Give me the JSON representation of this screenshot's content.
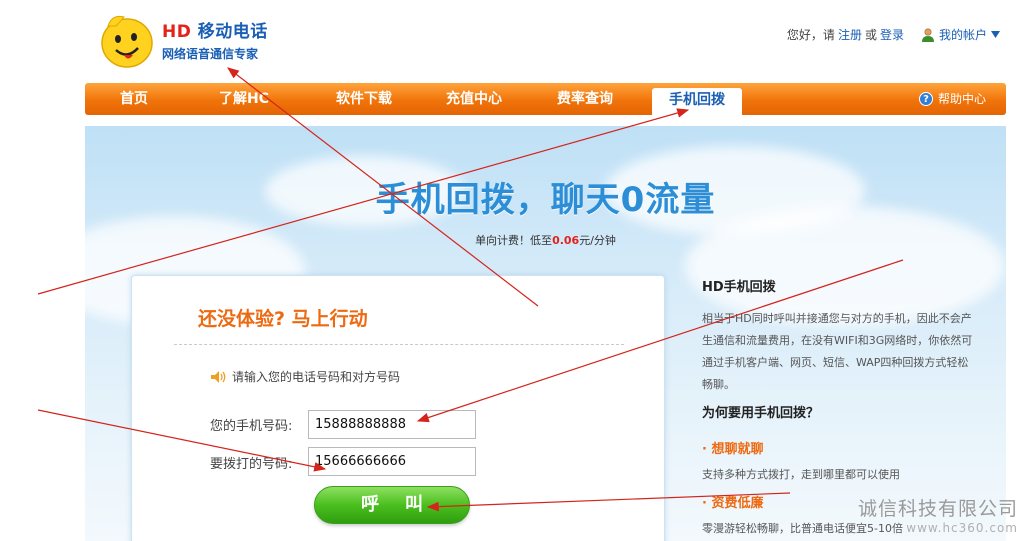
{
  "brand": {
    "name_prefix": "HD",
    "name_rest": " 移动电话",
    "slogan": "网络语音通信专家"
  },
  "top_links": {
    "greeting": "您好，请",
    "register": "注册",
    "or": "或",
    "login": "登录",
    "account": "我的帐户"
  },
  "nav": {
    "items": [
      {
        "label": "首页"
      },
      {
        "label": "了解HC"
      },
      {
        "label": "软件下载"
      },
      {
        "label": "充值中心"
      },
      {
        "label": "费率查询"
      },
      {
        "label": "手机回拨",
        "active": true
      }
    ],
    "help": "帮助中心"
  },
  "hero": {
    "title": "手机回拨，聊天0流量",
    "sub_prefix": "单向计费！低至",
    "price": "0.06",
    "sub_suffix": "元/分钟"
  },
  "form": {
    "title": "还没体验? 马上行动",
    "hint": "请输入您的电话号码和对方号码",
    "my_phone_label": "您的手机号码:",
    "my_phone_value": "15888888888",
    "dial_label": "要拨打的号码:",
    "dial_value": "15666666666",
    "call_button": "呼叫"
  },
  "info": {
    "title": "HD手机回拨",
    "desc": "相当于HD同时呼叫并接通您与对方的手机，因此不会产生通信和流量费用，在没有WIFI和3G网络时，你依然可通过手机客户端、网页、短信、WAP四种回拨方式轻松畅聊。",
    "why_title": "为何要用手机回拨？",
    "benefits": [
      {
        "title": "· 想聊就聊",
        "desc": "支持多种方式拨打，走到哪里都可以使用"
      },
      {
        "title": "· 资费低廉",
        "desc": "零漫游轻松畅聊，比普通电话便宜5-10倍"
      }
    ]
  },
  "watermark": {
    "company": "诚信科技有限公司",
    "url": "www.hc360.com"
  },
  "colors": {
    "nav_orange": "#f0740a",
    "brand_blue": "#1a5fb4",
    "accent_orange": "#ee6a12",
    "call_green": "#4bbf1f",
    "annotation_red": "#d4241b"
  },
  "icons": {
    "logo": "smiley-face-logo-icon",
    "user": "user-icon",
    "dropdown": "triangle-down-icon",
    "help": "question-circle-icon",
    "speaker": "speaker-icon"
  }
}
